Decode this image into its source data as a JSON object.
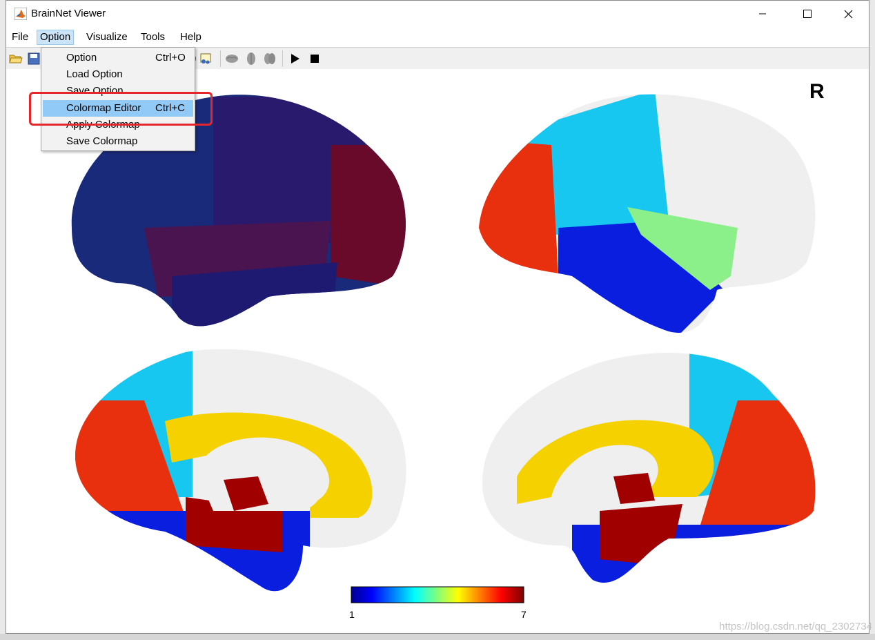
{
  "window": {
    "title": "BrainNet Viewer",
    "minimize_icon": "minimize-icon",
    "maximize_icon": "maximize-icon",
    "close_icon": "close-icon"
  },
  "menubar": {
    "items": [
      {
        "label": "File"
      },
      {
        "label": "Option",
        "active": true
      },
      {
        "label": "Visualize"
      },
      {
        "label": "Tools"
      },
      {
        "label": "Help"
      }
    ]
  },
  "option_menu": {
    "items": [
      {
        "label": "Option",
        "shortcut": "Ctrl+O"
      },
      {
        "label": "Load Option",
        "shortcut": ""
      },
      {
        "label": "Save Option",
        "shortcut": ""
      },
      {
        "label": "Colormap Editor",
        "shortcut": "Ctrl+C",
        "highlighted": true
      },
      {
        "label": "Apply Colormap",
        "shortcut": ""
      },
      {
        "label": "Save Colormap",
        "shortcut": ""
      }
    ]
  },
  "toolbar": {
    "icons": [
      "open-folder-icon",
      "save-icon",
      "print-icon",
      "camera-icon",
      "brain-lateral-icon",
      "brain-top-icon",
      "brain-medial-icon",
      "play-icon",
      "stop-icon"
    ]
  },
  "figure": {
    "hemisphere_label": "R",
    "colorbar": {
      "min": "1",
      "max": "7"
    },
    "colormap": [
      "#00008f",
      "#0000ff",
      "#00ffff",
      "#ffff00",
      "#ff0000",
      "#800000"
    ]
  },
  "watermark": "https://blog.csdn.net/qq_2302734"
}
